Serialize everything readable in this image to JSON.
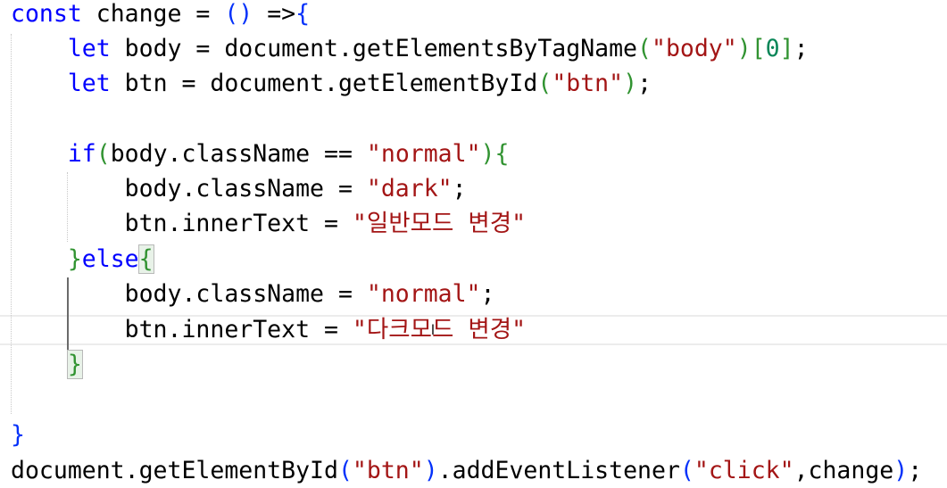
{
  "colors": {
    "keyword": "#0000ff",
    "string": "#a31515",
    "text": "#000000",
    "bracket_level1": "#0431fa",
    "bracket_level2": "#319331",
    "bracket_level3": "#7b3814",
    "number": "#098658",
    "current_line_border": "#ececec",
    "background": "#ffffff"
  },
  "icons": {
    "mouse_cursor": "i-beam-icon"
  },
  "code": {
    "line1": {
      "kw_const": "const",
      "text_change": " change = ",
      "paren_open": "(",
      "paren_close": ")",
      "arrow": " =>",
      "brace_open": "{"
    },
    "line2": {
      "indent": "    ",
      "kw_let": "let",
      "text": " body = document.getElementsByTagName",
      "paren_open": "(",
      "string": "\"body\"",
      "paren_close": ")",
      "bracket_open": "[",
      "number": "0",
      "bracket_close": "]",
      "semicolon": ";"
    },
    "line3": {
      "indent": "    ",
      "kw_let": "let",
      "text": " btn = document.getElementById",
      "paren_open": "(",
      "string": "\"btn\"",
      "paren_close": ")",
      "semicolon": ";"
    },
    "line5": {
      "indent": "    ",
      "kw_if": "if",
      "paren_open": "(",
      "text": "body.className == ",
      "string": "\"normal\"",
      "paren_close": ")",
      "brace_open": "{"
    },
    "line6": {
      "indent": "        ",
      "text": "body.className = ",
      "string": "\"dark\"",
      "semicolon": ";"
    },
    "line7": {
      "indent": "        ",
      "text": "btn.innerText = ",
      "string": "\"일반모드 변경\""
    },
    "line8": {
      "indent": "    ",
      "brace_close": "}",
      "kw_else": "else",
      "brace_open": "{"
    },
    "line9": {
      "indent": "        ",
      "text": "body.className = ",
      "string": "\"normal\"",
      "semicolon": ";"
    },
    "line10": {
      "indent": "        ",
      "text": "btn.innerText = ",
      "string": "\"다크모드 변경\""
    },
    "line11": {
      "indent": "    ",
      "brace_close": "}"
    },
    "line13": {
      "brace_close": "}"
    },
    "line14": {
      "text_a": "document.getElementById",
      "paren_open": "(",
      "string_btn": "\"btn\"",
      "paren_close": ")",
      "text_b": ".addEventListener",
      "paren2_open": "(",
      "string_click": "\"click\"",
      "text_c": ",change",
      "paren2_close": ")",
      "semicolon": ";"
    }
  }
}
